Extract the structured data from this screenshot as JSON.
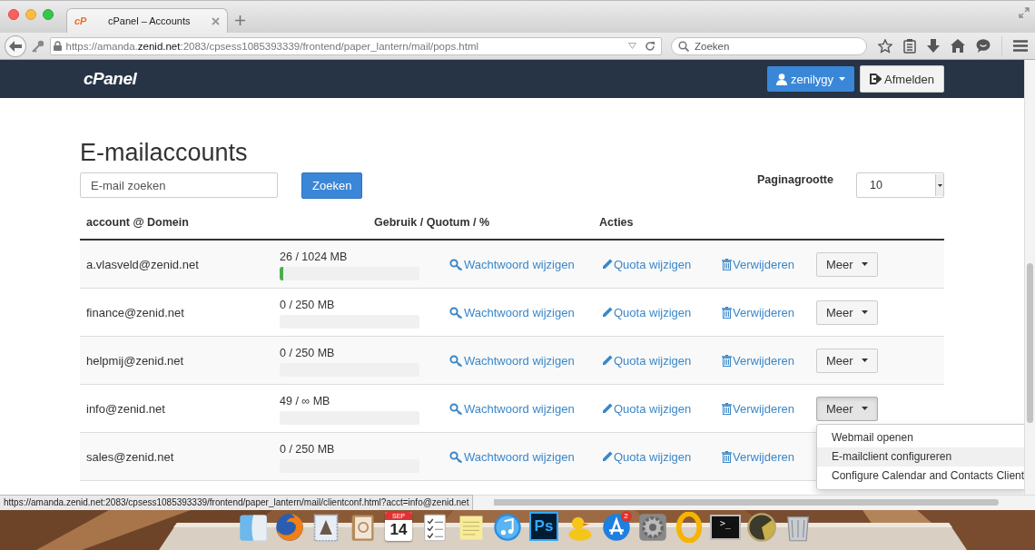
{
  "browser": {
    "tab": {
      "logo": "cP",
      "title": "cPanel – Accounts"
    },
    "url": "https://amanda.**zenid.net**:2083/cpsess1085393339/frontend/paper_lantern/mail/pops.html",
    "search": {
      "placeholder": "Zoeken"
    }
  },
  "header": {
    "logo": "cPanel",
    "user": "zenilygy",
    "logout": "Afmelden"
  },
  "page": {
    "title": "E-mailaccounts",
    "search": {
      "placeholder": "E-mail zoeken"
    },
    "search_button": "Zoeken",
    "page_size_label": "Paginagrootte",
    "page_size": "10"
  },
  "table": {
    "columns": [
      "account @ Domein",
      "Gebruik / Quotum / %",
      "Acties"
    ],
    "rows": [
      {
        "account": "a.vlasveld@zenid.net",
        "usage": "26 / 1024 MB",
        "level": 0.025,
        "actions": [
          "Wachtwoord wijzigen",
          "Quota wijzigen",
          "Verwijderen"
        ],
        "more": "Meer",
        "expanded": false
      },
      {
        "account": "finance@zenid.net",
        "usage": "0 / 250 MB",
        "level": 0,
        "actions": [
          "Wachtwoord wijzigen",
          "Quota wijzigen",
          "Verwijderen"
        ],
        "more": "Meer",
        "expanded": false
      },
      {
        "account": "helpmij@zenid.net",
        "usage": "0 / 250 MB",
        "level": 0,
        "actions": [
          "Wachtwoord wijzigen",
          "Quota wijzigen",
          "Verwijderen"
        ],
        "more": "Meer",
        "expanded": false
      },
      {
        "account": "info@zenid.net",
        "usage": "49 / ∞ MB",
        "level": 0,
        "actions": [
          "Wachtwoord wijzigen",
          "Quota wijzigen",
          "Verwijderen"
        ],
        "more": "Meer",
        "expanded": true
      },
      {
        "account": "sales@zenid.net",
        "usage": "0 / 250 MB",
        "level": 0,
        "actions": [
          "Wachtwoord wijzigen",
          "Quota wijzigen",
          "Verwijderen"
        ]
      }
    ]
  },
  "menu": {
    "items": [
      {
        "label": "Webmail openen",
        "selected": false
      },
      {
        "label": "E-mailclient configureren",
        "selected": true
      },
      {
        "label": "Configure Calendar and Contacts Client",
        "selected": false
      }
    ]
  },
  "status_bar": "https://amanda.zenid.net:2083/cpsess1085393339/frontend/paper_lantern/mail/clientconf.html?acct=info@zenid.net",
  "dock": {
    "items": [
      {
        "kind": "finder"
      },
      {
        "kind": "globe"
      },
      {
        "kind": "stamp"
      },
      {
        "kind": "contacts"
      },
      {
        "kind": "calendar",
        "month": "SEP",
        "day": "14"
      },
      {
        "kind": "checklist"
      },
      {
        "kind": "notepad"
      },
      {
        "kind": "music"
      },
      {
        "kind": "tile",
        "label": "Ps"
      },
      {
        "kind": "duck"
      },
      {
        "kind": "store",
        "badge": "2"
      },
      {
        "kind": "gear"
      },
      {
        "kind": "ring"
      },
      {
        "kind": "terminal",
        "label": ">_"
      },
      {
        "kind": "radar"
      },
      {
        "kind": "trash"
      }
    ]
  }
}
